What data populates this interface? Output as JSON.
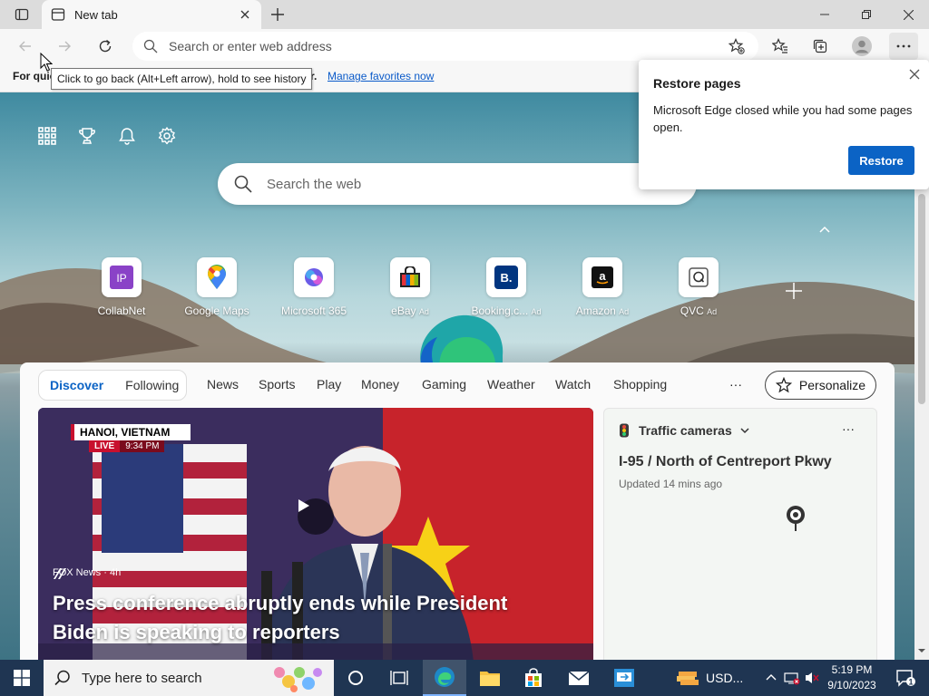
{
  "browser": {
    "tab_title": "New tab",
    "address_placeholder": "Search or enter web address",
    "favorites_bar": {
      "lead_text": "For quic",
      "lead_tail": "r.",
      "link_text": "Manage favorites now"
    },
    "tooltip": "Click to go back (Alt+Left arrow), hold to see history"
  },
  "restore_popup": {
    "title": "Restore pages",
    "message": "Microsoft Edge closed while you had some pages open.",
    "button_label": "Restore"
  },
  "new_tab_page": {
    "search_placeholder": "Search the web",
    "quick_links": [
      {
        "label": "CollabNet",
        "ad": ""
      },
      {
        "label": "Google Maps",
        "ad": ""
      },
      {
        "label": "Microsoft 365",
        "ad": ""
      },
      {
        "label": "eBay",
        "ad": "Ad"
      },
      {
        "label": "Booking.c...",
        "ad": "Ad"
      },
      {
        "label": "Amazon",
        "ad": "Ad"
      },
      {
        "label": "QVC",
        "ad": "Ad"
      }
    ],
    "quick_link_initials": {
      "collabnet": "IP",
      "booking": "B."
    }
  },
  "feed": {
    "pill_tabs": {
      "active": "Discover",
      "other": "Following"
    },
    "nav_tabs": [
      "News",
      "Sports",
      "Play",
      "Money",
      "Gaming",
      "Weather",
      "Watch",
      "Shopping"
    ],
    "more_label": "···",
    "personalize_label": "Personalize",
    "hero": {
      "badge_location": "HANOI, VIETNAM",
      "badge_live": "LIVE",
      "badge_time": "9:34 PM",
      "source": "FOX News · 4h",
      "headline": "Press conference abruptly ends while President Biden is speaking to reporters"
    },
    "traffic": {
      "title": "Traffic cameras",
      "location": "I-95 / North of Centreport Pkwy",
      "updated": "Updated 14 mins ago",
      "more_label": "···"
    }
  },
  "taskbar": {
    "search_placeholder": "Type here to search",
    "usd_label": "USD...",
    "time": "5:19 PM",
    "date": "9/10/2023",
    "notification_count": "1"
  },
  "colors": {
    "accent": "#0b63c5",
    "taskbar": "#1f3552",
    "link": "#0a5ac9"
  }
}
